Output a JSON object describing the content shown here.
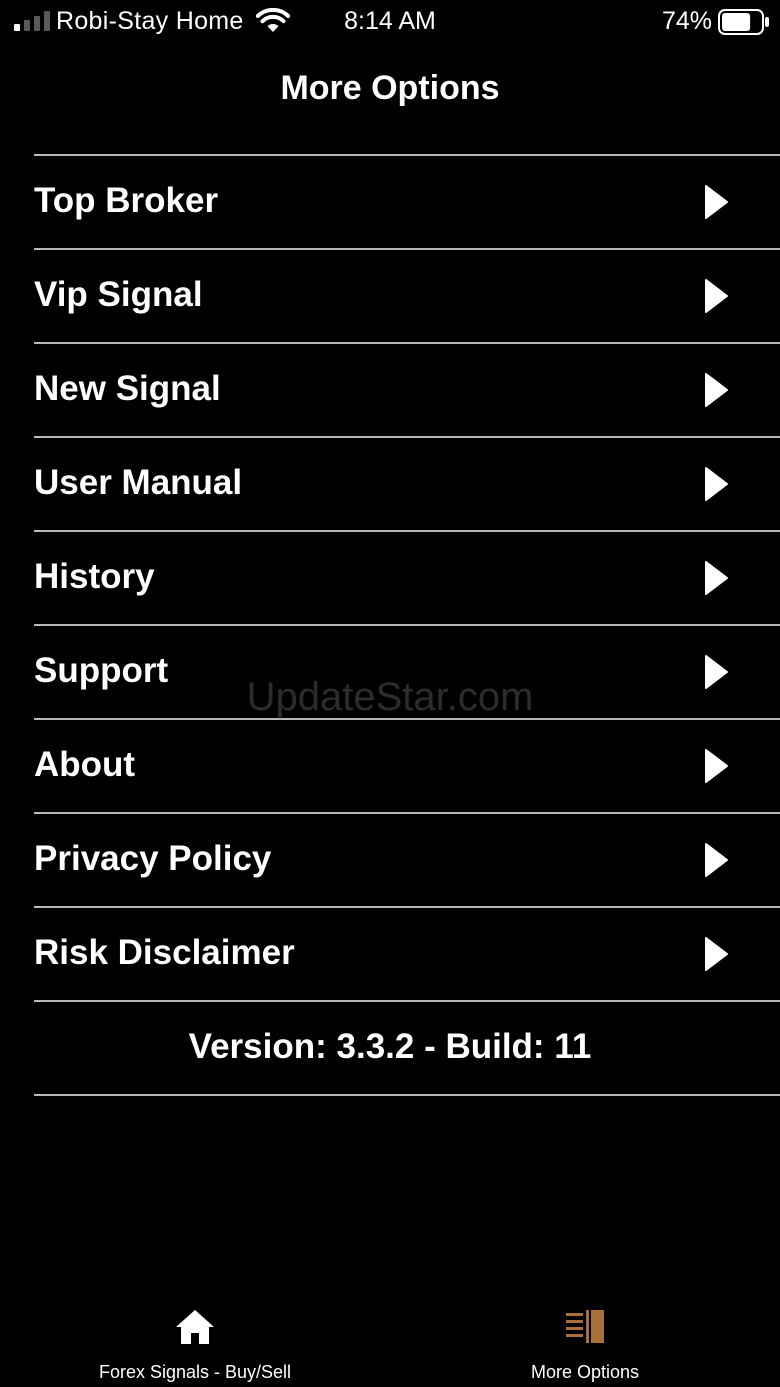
{
  "status_bar": {
    "carrier": "Robi-Stay Home",
    "time": "8:14 AM",
    "battery_percent": "74%",
    "battery_level": 0.74,
    "signal_bars_active": 1,
    "icons": [
      "signal-strength-icon",
      "wifi-icon",
      "battery-icon"
    ]
  },
  "header": {
    "title": "More Options"
  },
  "menu": {
    "items": [
      {
        "label": "Top Broker",
        "icon": "chevron-right-icon"
      },
      {
        "label": "Vip Signal",
        "icon": "chevron-right-icon"
      },
      {
        "label": "New Signal",
        "icon": "chevron-right-icon"
      },
      {
        "label": "User Manual",
        "icon": "chevron-right-icon"
      },
      {
        "label": "History",
        "icon": "chevron-right-icon"
      },
      {
        "label": "Support",
        "icon": "chevron-right-icon"
      },
      {
        "label": "About",
        "icon": "chevron-right-icon"
      },
      {
        "label": "Privacy Policy",
        "icon": "chevron-right-icon"
      },
      {
        "label": "Risk Disclaimer",
        "icon": "chevron-right-icon"
      }
    ],
    "version_text": "Version: 3.3.2 - Build: 11"
  },
  "watermark": "UpdateStar.com",
  "tab_bar": {
    "tabs": [
      {
        "label": "Forex Signals - Buy/Sell",
        "icon": "home-icon",
        "active": false
      },
      {
        "label": "More Options",
        "icon": "more-options-icon",
        "active": true
      }
    ],
    "active_color": "#a8703a",
    "inactive_color": "#ffffff"
  },
  "colors": {
    "background": "#000000",
    "text": "#ffffff",
    "divider": "#b8b8b8"
  }
}
